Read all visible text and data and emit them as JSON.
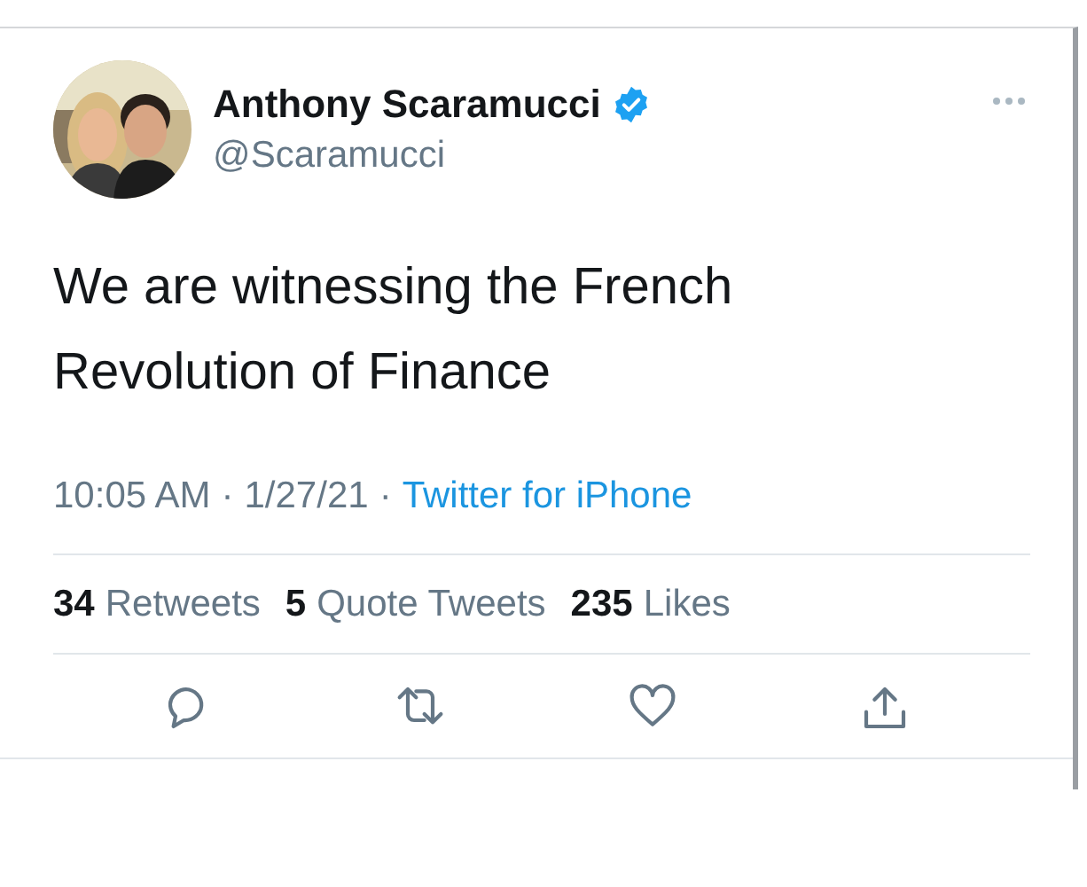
{
  "tweet": {
    "author": {
      "name": "Anthony Scaramucci",
      "verified": true,
      "handle": "@Scaramucci"
    },
    "text": "We are witnessing the French Revolution of Finance",
    "time": "10:05 AM",
    "separator_1": "·",
    "date": "1/27/21",
    "separator_2": "·",
    "source": "Twitter for iPhone",
    "stats": [
      {
        "count": "34",
        "label": "Retweets"
      },
      {
        "count": "5",
        "label": "Quote Tweets"
      },
      {
        "count": "235",
        "label": "Likes"
      }
    ]
  }
}
